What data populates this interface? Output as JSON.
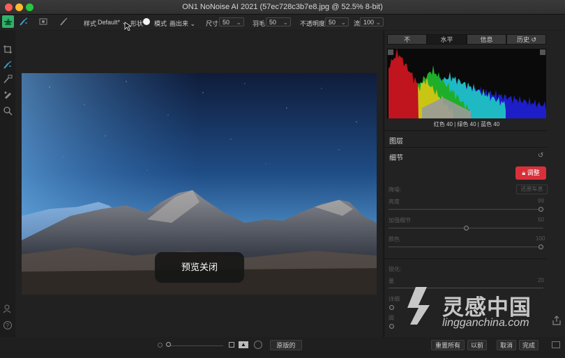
{
  "window": {
    "title": "ON1 NoNoise AI 2021 (57ec728c3b7e8.jpg @ 52.5% 8-bit)"
  },
  "toolbar": {
    "style_label": "样式",
    "style_value": "Default*",
    "shape_label": "形状",
    "mode_label": "模式",
    "mode_value": "画出来",
    "size_label": "尺寸",
    "size_value": "50",
    "feather_label": "羽毛",
    "feather_value": "50",
    "opacity_label": "不透明度",
    "opacity_value": "50",
    "flow_label": "流",
    "flow_value": "100"
  },
  "panel": {
    "tabs": [
      "不",
      "水平",
      "信息",
      "历史"
    ],
    "active_tab": 1,
    "histogram_readout": "红色  40  | 绿色  40  | 蓝色  40",
    "layers_title": "图层",
    "detail_title": "细节",
    "adjust_button": "调整",
    "denoise_label": "降噪:",
    "reset_detail_button": "还原车息",
    "sliders": [
      {
        "label": "亮度",
        "value": "99",
        "fraction": 1.0
      },
      {
        "label": "加强细节",
        "value": "50",
        "fraction": 0.5
      },
      {
        "label": "颜色",
        "value": "100",
        "fraction": 1.0
      }
    ],
    "sharpen_label": "锐化:",
    "amount_label": "量",
    "amount_value": "20",
    "threshold_label": "详细",
    "halo_label": "阈",
    "histogram_colors": {
      "red": "#c0141e",
      "green": "#1fae2a",
      "blue": "#1e1ec8",
      "cyan": "#1fb9c3",
      "yellow": "#c9c515",
      "gray": "#9a9a9a"
    }
  },
  "canvas": {
    "preview_badge": "预览关闭"
  },
  "bottom": {
    "original_button": "原版的",
    "reset_all_button": "重置所有",
    "previous_button": "以前",
    "cancel_button": "取消",
    "done_button": "完成"
  },
  "watermark": {
    "text": "灵感中国",
    "url": "lingganchina.com"
  }
}
